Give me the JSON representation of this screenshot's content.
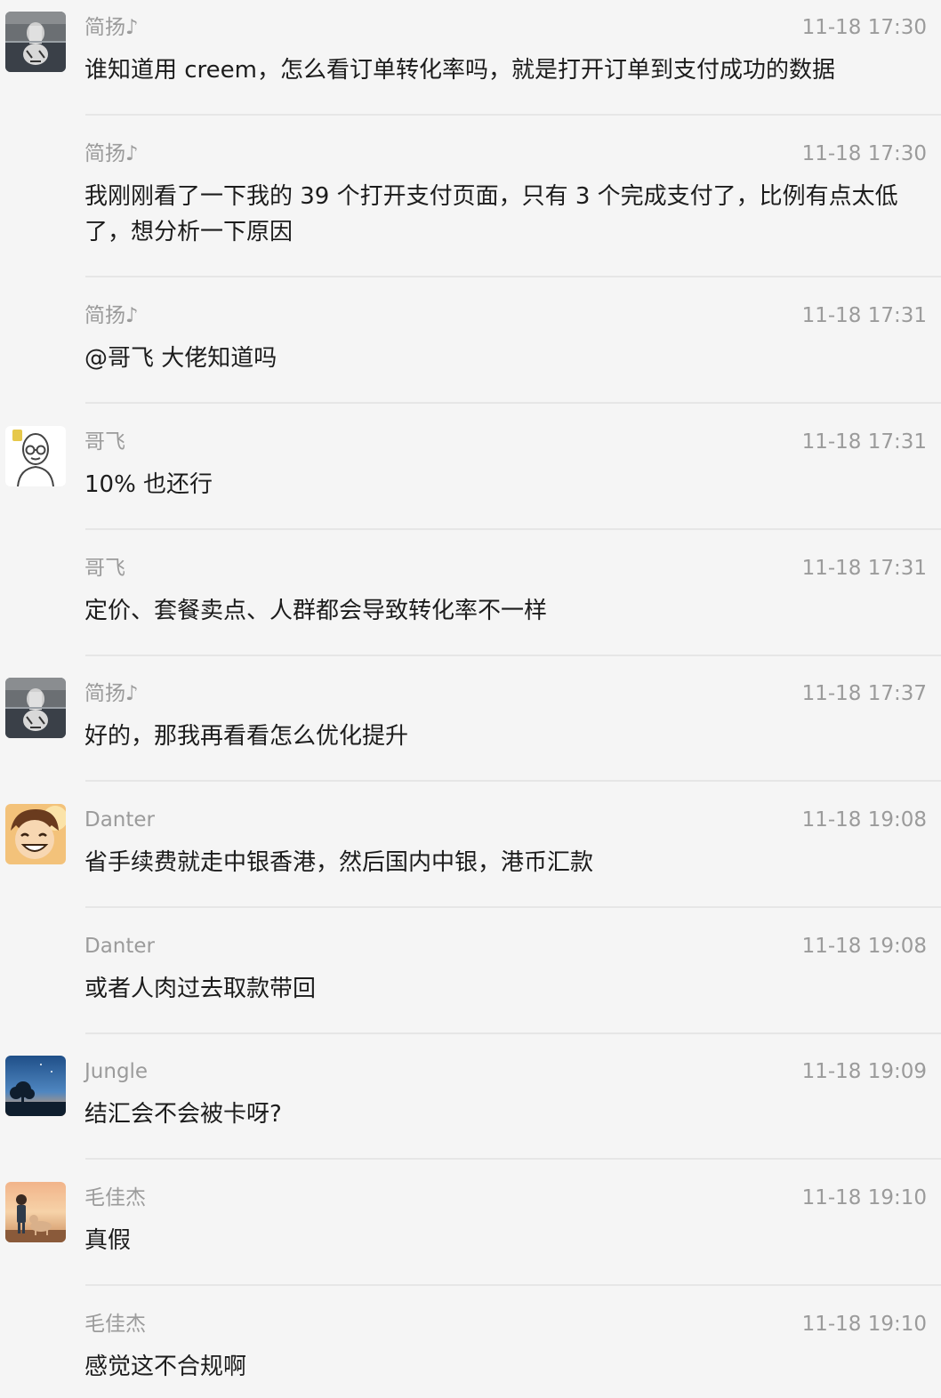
{
  "messages": [
    {
      "sender": "简扬♪",
      "time": "11-18 17:30",
      "text": "谁知道用 creem，怎么看订单转化率吗，就是打开订单到支付成功的数据",
      "avatar": "tiger-reflection-avatar"
    },
    {
      "sender": "简扬♪",
      "time": "11-18 17:30",
      "text": "我刚刚看了一下我的 39 个打开支付页面，只有 3 个完成支付了，比例有点太低了，想分析一下原因",
      "avatar": ""
    },
    {
      "sender": "简扬♪",
      "time": "11-18 17:31",
      "text": "@哥飞  大佬知道吗",
      "avatar": ""
    },
    {
      "sender": "哥飞",
      "time": "11-18 17:31",
      "text": "10% 也还行",
      "avatar": "cartoon-man-glasses-avatar"
    },
    {
      "sender": "哥飞",
      "time": "11-18 17:31",
      "text": "定价、套餐卖点、人群都会导致转化率不一样",
      "avatar": ""
    },
    {
      "sender": "简扬♪",
      "time": "11-18 17:37",
      "text": "好的，那我再看看怎么优化提升",
      "avatar": "tiger-reflection-avatar"
    },
    {
      "sender": "Danter",
      "time": "11-18 19:08",
      "text": "省手续费就走中银香港，然后国内中银，港币汇款",
      "avatar": "anime-boy-smiling-avatar"
    },
    {
      "sender": "Danter",
      "time": "11-18 19:08",
      "text": "或者人肉过去取款带回",
      "avatar": ""
    },
    {
      "sender": "Jungle",
      "time": "11-18 19:09",
      "text": "结汇会不会被卡呀?",
      "avatar": "sunset-tree-avatar"
    },
    {
      "sender": "毛佳杰",
      "time": "11-18 19:10",
      "text": "真假",
      "avatar": "boy-and-dog-sunset-avatar"
    },
    {
      "sender": "毛佳杰",
      "time": "11-18 19:10",
      "text": "感觉这不合规啊",
      "avatar": ""
    }
  ],
  "colors": {
    "background": "#f5f5f5",
    "meta_text": "#9b9b9b",
    "body_text": "#1c1c1c",
    "divider": "#e6e6e6"
  }
}
